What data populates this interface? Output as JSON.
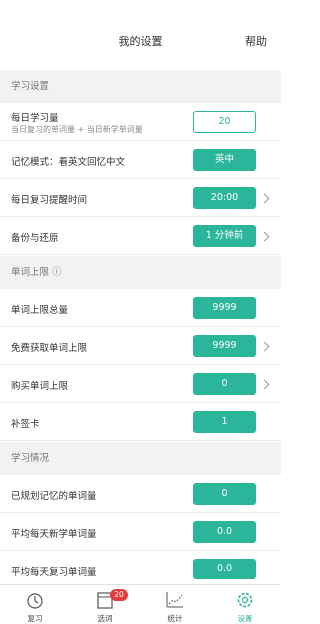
{
  "header": {
    "title": "我的设置",
    "help": "帮助"
  },
  "sections": {
    "study": "学习设置",
    "limit": "单词上限 ⓘ",
    "status": "学习情况"
  },
  "rows": {
    "daily": {
      "label": "每日学习量",
      "sub": "当日复习的单词量 + 当日新学单词量",
      "value": "20"
    },
    "mode": {
      "label": "记忆模式：看英文回忆中文",
      "value": "英中"
    },
    "reminder": {
      "label": "每日复习提醒时间",
      "value": "20:00"
    },
    "backup": {
      "label": "备份与还原",
      "value": "1 分钟前"
    },
    "total": {
      "label": "单词上限总量",
      "value": "9999"
    },
    "free": {
      "label": "免费获取单词上限",
      "value": "9999"
    },
    "buy": {
      "label": "购买单词上限",
      "value": "0"
    },
    "card": {
      "label": "补签卡",
      "value": "1"
    },
    "planned": {
      "label": "已规划记忆的单词量",
      "value": "0"
    },
    "avg_new": {
      "label": "平均每天新学单词量",
      "value": "0.0"
    },
    "avg_review": {
      "label": "平均每天复习单词量",
      "value": "0.0"
    }
  },
  "tabs": [
    {
      "label": "复习",
      "icon": "review-icon"
    },
    {
      "label": "选词",
      "icon": "select-words-icon",
      "badge": "20"
    },
    {
      "label": "统计",
      "icon": "stats-icon"
    },
    {
      "label": "设置",
      "icon": "settings-icon"
    }
  ],
  "colors": {
    "accent": "#2bb59a",
    "badge": "#e63b3b",
    "section_bg": "#f2f2f2"
  }
}
